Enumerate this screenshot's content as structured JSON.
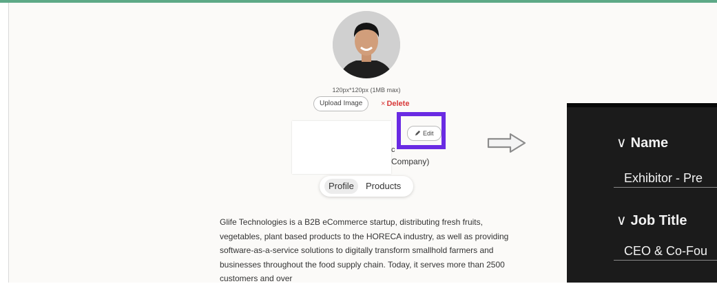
{
  "avatar": {
    "size_hint": "120px*120px (1MB max)",
    "upload_label": "Upload Image",
    "delete_label": "Delete",
    "delete_icon": "×"
  },
  "card": {
    "edit_label": "Edit",
    "edit_icon": "pencil-icon",
    "partial_line_1": "c",
    "partial_line_2": "Company)"
  },
  "tabs": [
    {
      "label": "Profile",
      "active": true
    },
    {
      "label": "Products",
      "active": false
    }
  ],
  "description": "Glife Technologies is a B2B eCommerce startup, distributing fresh fruits, vegetables, plant based products to the HORECA industry, as well as providing software-as-a-service solutions to digitally transform smallhold farmers and businesses throughout the food supply chain. Today, it serves more than 2500 customers and over",
  "dark_panel": {
    "name_label": "Name",
    "name_value": "Exhibitor - Pre",
    "job_label": "Job Title",
    "job_value": "CEO & Co-Fou",
    "chevron": "∨"
  },
  "colors": {
    "highlight": "#6a2be3",
    "delete": "#d83a3a",
    "dark_bg": "#1b1b1b",
    "accent_line": "#5da987"
  }
}
